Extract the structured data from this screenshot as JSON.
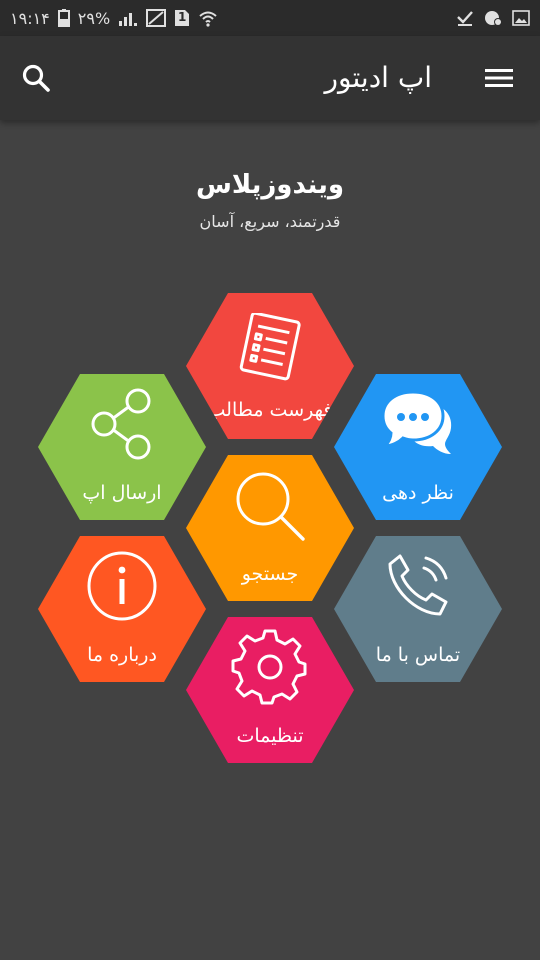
{
  "status_bar": {
    "time": "۱۹:۱۴",
    "battery": "۲۹%",
    "sim_number": "1"
  },
  "app_bar": {
    "title": "اپ ادیتور"
  },
  "header": {
    "title": "ویندوزپلاس",
    "subtitle": "قدرتمند، سریع، آسان"
  },
  "menu_items": [
    {
      "id": "contents",
      "label": "فهرست مطالب",
      "color": "#f2473f",
      "icon": "list-document-icon"
    },
    {
      "id": "share",
      "label": "ارسال اپ",
      "color": "#8bc34a",
      "icon": "share-icon"
    },
    {
      "id": "feedback",
      "label": "نظر دهی",
      "color": "#2196f3",
      "icon": "chat-bubble-icon"
    },
    {
      "id": "search",
      "label": "جستجو",
      "color": "#ff9800",
      "icon": "search-icon"
    },
    {
      "id": "about",
      "label": "درباره ما",
      "color": "#ff5722",
      "icon": "info-icon"
    },
    {
      "id": "contact",
      "label": "تماس با ما",
      "color": "#607d8b",
      "icon": "phone-icon"
    },
    {
      "id": "settings",
      "label": "تنظیمات",
      "color": "#e91e63",
      "icon": "gear-icon"
    }
  ]
}
